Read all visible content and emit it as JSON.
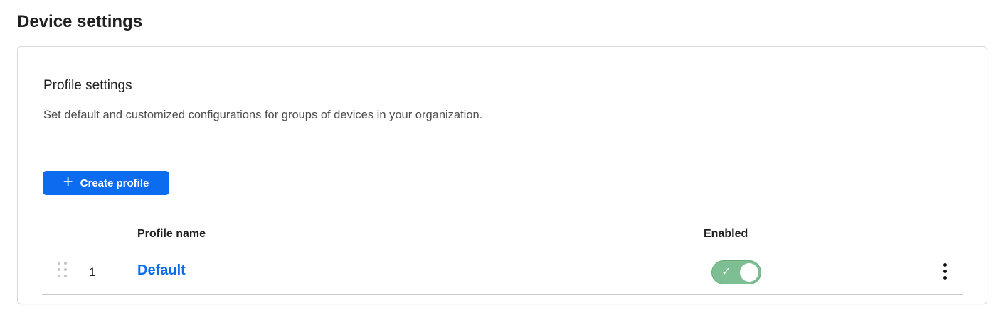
{
  "page": {
    "title": "Device settings"
  },
  "profile_settings": {
    "title": "Profile settings",
    "description": "Set default and customized configurations for groups of devices in your organization.",
    "create_button": {
      "icon": "plus-icon",
      "label": "Create profile"
    }
  },
  "table": {
    "columns": [
      "Profile name",
      "Enabled"
    ],
    "rows": [
      {
        "index": "1",
        "name": "Default",
        "enabled": true
      }
    ]
  },
  "colors": {
    "accent": "#0b6cf0",
    "toggle_on": "#7dbf92"
  }
}
